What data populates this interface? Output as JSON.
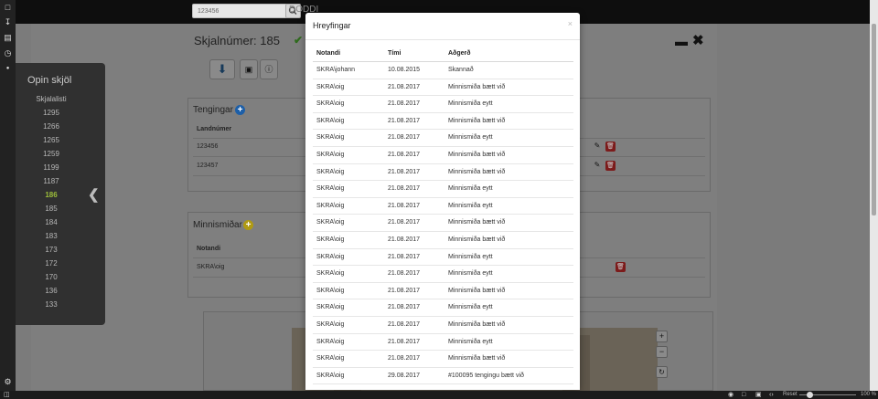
{
  "topbar": {
    "search_value": "123456",
    "brand": "DODDI"
  },
  "main": {
    "title": "Skjalnúmer: 185",
    "tengingar": {
      "title": "Tengingar",
      "column": "Landnúmer",
      "rows": [
        "123456",
        "123457"
      ]
    },
    "minnismidar": {
      "title": "Minnismiðar",
      "column": "Notandi",
      "rows": [
        "SKRA\\oig"
      ]
    }
  },
  "flyout": {
    "title": "Opin skjöl",
    "subtitle": "Skjalalisti",
    "items": [
      "1295",
      "1266",
      "1265",
      "1259",
      "1199",
      "1187",
      "186",
      "185",
      "184",
      "183",
      "173",
      "172",
      "170",
      "136",
      "133"
    ],
    "active": "186"
  },
  "modal": {
    "title": "Hreyfingar",
    "close": "×",
    "columns": [
      "Notandi",
      "Tími",
      "Aðgerð"
    ],
    "rows": [
      [
        "SKRA\\johann",
        "10.08.2015",
        "Skannað"
      ],
      [
        "SKRA\\oig",
        "21.08.2017",
        "Minnismiða bætt við"
      ],
      [
        "SKRA\\oig",
        "21.08.2017",
        "Minnismiða eytt"
      ],
      [
        "SKRA\\oig",
        "21.08.2017",
        "Minnismiða bætt við"
      ],
      [
        "SKRA\\oig",
        "21.08.2017",
        "Minnismiða eytt"
      ],
      [
        "SKRA\\oig",
        "21.08.2017",
        "Minnismiða bætt við"
      ],
      [
        "SKRA\\oig",
        "21.08.2017",
        "Minnismiða bætt við"
      ],
      [
        "SKRA\\oig",
        "21.08.2017",
        "Minnismiða eytt"
      ],
      [
        "SKRA\\oig",
        "21.08.2017",
        "Minnismiða eytt"
      ],
      [
        "SKRA\\oig",
        "21.08.2017",
        "Minnismiða bætt við"
      ],
      [
        "SKRA\\oig",
        "21.08.2017",
        "Minnismiða bætt við"
      ],
      [
        "SKRA\\oig",
        "21.08.2017",
        "Minnismiða eytt"
      ],
      [
        "SKRA\\oig",
        "21.08.2017",
        "Minnismiða eytt"
      ],
      [
        "SKRA\\oig",
        "21.08.2017",
        "Minnismiða bætt við"
      ],
      [
        "SKRA\\oig",
        "21.08.2017",
        "Minnismiða eytt"
      ],
      [
        "SKRA\\oig",
        "21.08.2017",
        "Minnismiða bætt við"
      ],
      [
        "SKRA\\oig",
        "21.08.2017",
        "Minnismiða eytt"
      ],
      [
        "SKRA\\oig",
        "21.08.2017",
        "Minnismiða bætt við"
      ],
      [
        "SKRA\\oig",
        "29.08.2017",
        "#100095 tengingu bætt við"
      ]
    ]
  },
  "statusbar": {
    "reset": "Reset",
    "zoom": "100 %"
  },
  "colors": {
    "active_item": "#9cbd3a",
    "check": "#2f6b1d",
    "add_blue": "#1d5fa8",
    "add_yellow": "#b09a12",
    "delete": "#7c1b1b"
  }
}
